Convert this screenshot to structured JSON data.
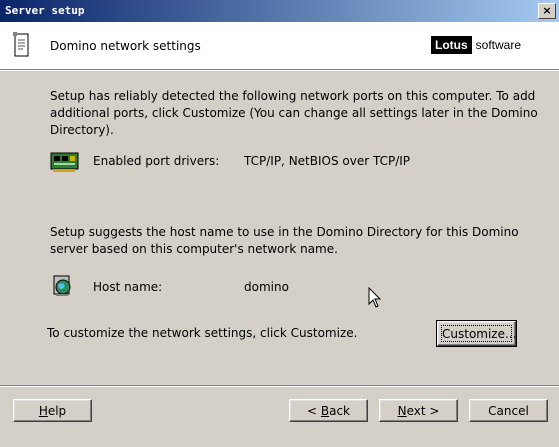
{
  "window": {
    "title": "Server setup",
    "close_glyph": "×"
  },
  "header": {
    "title": "Domino network settings",
    "logo_brand": "Lotus",
    "logo_suffix": "software"
  },
  "intro_text": "Setup has reliably detected the following network ports on this computer. To add additional ports, click Customize (You can change all settings later in the Domino Directory).",
  "ports": {
    "label": "Enabled port drivers:",
    "value": "TCP/IP, NetBIOS over TCP/IP",
    "icon": "network-card-icon"
  },
  "host_intro": "Setup suggests the host name to use in the Domino Directory for this Domino server based on this computer's network name.",
  "host": {
    "label": "Host name:",
    "value": "domino",
    "icon": "globe-computer-icon"
  },
  "customize": {
    "text": "To customize the network settings, click Customize.",
    "button_label": "Customize..."
  },
  "buttons": {
    "help_accel": "H",
    "help_rest": "elp",
    "back_prefix": "< ",
    "back_accel": "B",
    "back_rest": "ack",
    "next_accel": "N",
    "next_rest": "ext >",
    "cancel": "Cancel"
  },
  "colors": {
    "titlebar_start": "#0a246a",
    "titlebar_end": "#a6caf0",
    "dialog_bg": "#d4d0c8"
  }
}
